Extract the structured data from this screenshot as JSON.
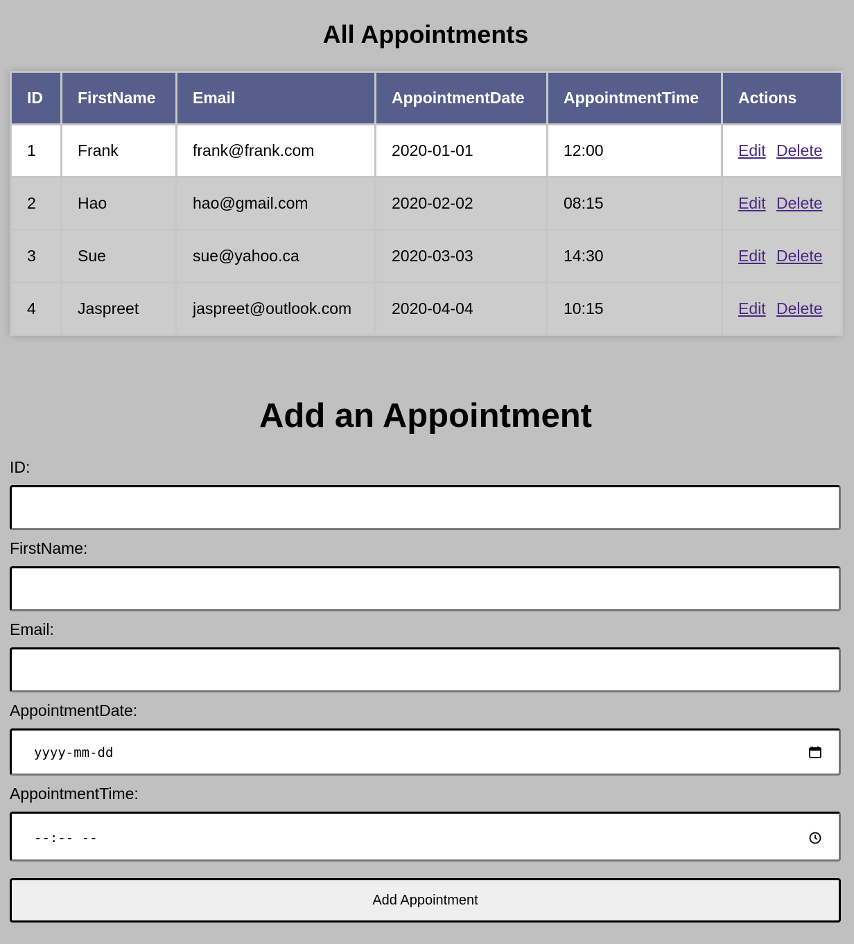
{
  "list": {
    "title": "All Appointments",
    "columns": [
      "ID",
      "FirstName",
      "Email",
      "AppointmentDate",
      "AppointmentTime",
      "Actions"
    ],
    "rows": [
      {
        "id": "1",
        "first_name": "Frank",
        "email": "frank@frank.com",
        "date": "2020-01-01",
        "time": "12:00"
      },
      {
        "id": "2",
        "first_name": "Hao",
        "email": "hao@gmail.com",
        "date": "2020-02-02",
        "time": "08:15"
      },
      {
        "id": "3",
        "first_name": "Sue",
        "email": "sue@yahoo.ca",
        "date": "2020-03-03",
        "time": "14:30"
      },
      {
        "id": "4",
        "first_name": "Jaspreet",
        "email": "jaspreet@outlook.com",
        "date": "2020-04-04",
        "time": "10:15"
      }
    ],
    "action_edit": "Edit",
    "action_delete": "Delete"
  },
  "form": {
    "title": "Add an Appointment",
    "id_label": "ID:",
    "id_value": "",
    "first_name_label": "FirstName:",
    "first_name_value": "",
    "email_label": "Email:",
    "email_value": "",
    "date_label": "AppointmentDate:",
    "date_placeholder": "yyyy-mm-dd",
    "date_icon": "calendar-icon",
    "time_label": "AppointmentTime:",
    "time_placeholder": "--:-- --",
    "time_icon": "clock-icon",
    "submit_label": "Add Appointment"
  },
  "colors": {
    "page_background": "#c0c0c0",
    "header_background": "#565f8b",
    "header_text": "#ffffff",
    "row_odd": "#ffffff",
    "row_even": "#cccccc",
    "link": "#4b2a83",
    "button_background": "#efefef"
  }
}
